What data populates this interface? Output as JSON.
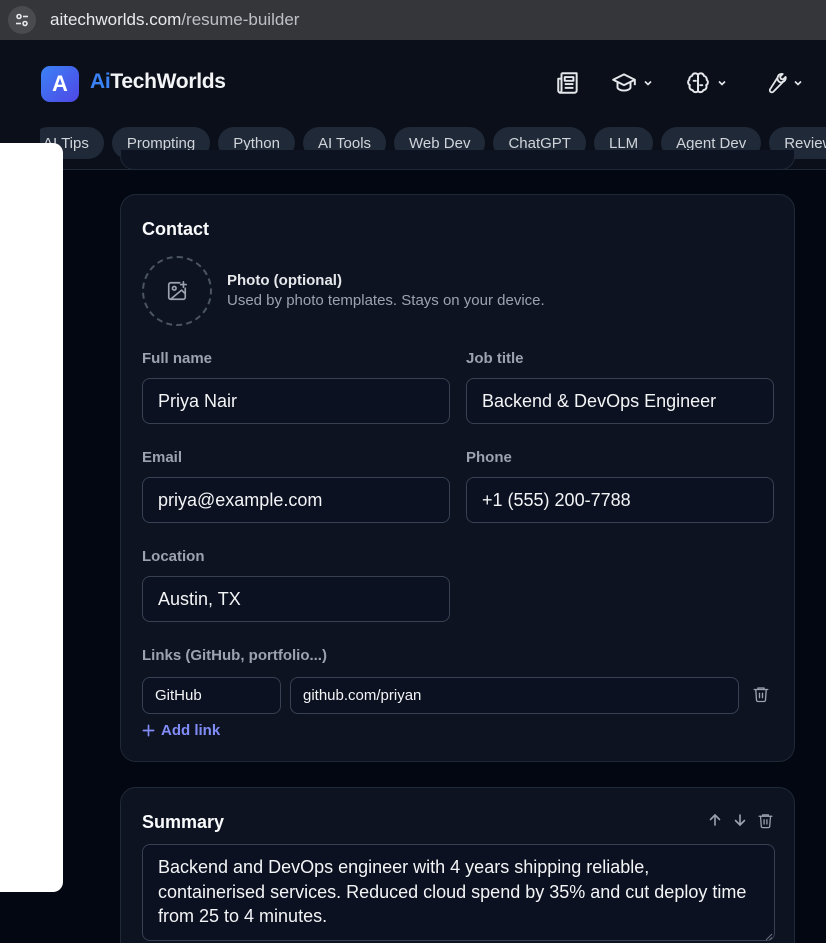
{
  "browser": {
    "url_host": "aitechworlds.com",
    "url_path": "/resume-builder"
  },
  "brand": {
    "ai": "Ai",
    "rest": "TechWorlds",
    "logo_letter": "A"
  },
  "nav": {
    "icons": [
      "newspaper-icon",
      "graduation-cap-icon",
      "brain-icon",
      "wrench-icon"
    ]
  },
  "chips": [
    "AI Tips",
    "Prompting",
    "Python",
    "AI Tools",
    "Web Dev",
    "ChatGPT",
    "LLM",
    "Agent Dev",
    "Reviews"
  ],
  "contact": {
    "title": "Contact",
    "photo_title": "Photo (optional)",
    "photo_desc": "Used by photo templates. Stays on your device.",
    "full_name": {
      "label": "Full name",
      "value": "Priya Nair"
    },
    "job_title": {
      "label": "Job title",
      "value": "Backend & DevOps Engineer"
    },
    "email": {
      "label": "Email",
      "value": "priya@example.com"
    },
    "phone": {
      "label": "Phone",
      "value": "+1 (555) 200-7788"
    },
    "location": {
      "label": "Location",
      "value": "Austin, TX"
    },
    "links_label": "Links (GitHub, portfolio...)",
    "links": [
      {
        "name": "GitHub",
        "url": "github.com/priyan"
      }
    ],
    "add_link": "Add link"
  },
  "summary": {
    "title": "Summary",
    "text": "Backend and DevOps engineer with 4 years shipping reliable, containerised services. Reduced cloud spend by 35% and cut deploy time from 25 to 4 minutes."
  },
  "colors": {
    "accent": "#3b82f6",
    "link": "#818cf8",
    "card": "#0d1320",
    "page": "#030712"
  }
}
